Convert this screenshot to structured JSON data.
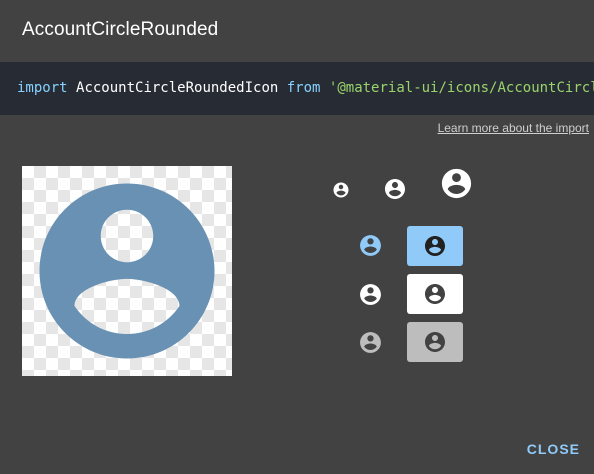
{
  "dialog": {
    "title": "AccountCircleRounded"
  },
  "import_code": {
    "keyword_import": "import",
    "component": "AccountCircleRoundedIcon",
    "keyword_from": "from",
    "module": "'@material-ui/icons/AccountCircleRounded';"
  },
  "learn_more": {
    "label": "Learn more about the import"
  },
  "icon": {
    "name": "account-circle-rounded-icon"
  },
  "preview": {
    "icon_color": "#6891b3"
  },
  "variants": {
    "dark_bg": "#424242",
    "light_bg": "#90caf9",
    "white_bg": "#ffffff",
    "grey_bg": "#bdbdbd",
    "primary_icon": "#90caf9",
    "dark_icon": "#212121",
    "light_icon": "#ffffff",
    "muted_icon": "#bdbdbd"
  },
  "actions": {
    "close_label": "CLOSE"
  }
}
